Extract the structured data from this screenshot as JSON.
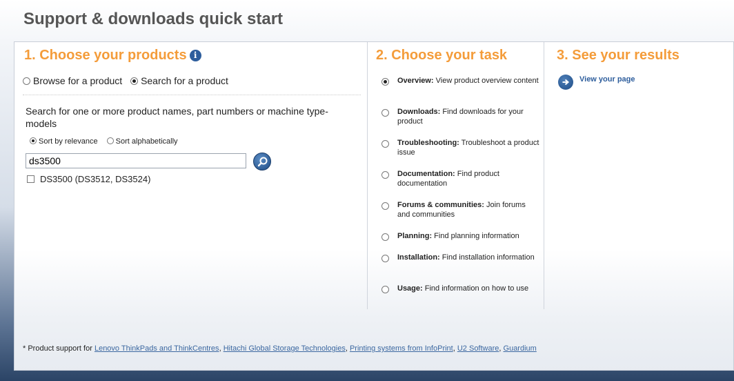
{
  "page": {
    "title": "Support & downloads quick start"
  },
  "step1": {
    "heading": "1. Choose your products",
    "info_icon": "info-icon",
    "modes": [
      {
        "label": "Browse for a product",
        "checked": false
      },
      {
        "label": "Search for a product",
        "checked": true
      }
    ],
    "search_help": "Search for one or more product names, part numbers or machine type-models",
    "sort_options": [
      {
        "label": "Sort by relevance",
        "checked": true
      },
      {
        "label": "Sort alphabetically",
        "checked": false
      }
    ],
    "search_value": "ds3500",
    "search_button_icon": "search-icon",
    "results": [
      {
        "label": "DS3500 (DS3512, DS3524)",
        "checked": false
      }
    ]
  },
  "step2": {
    "heading": "2. Choose your task",
    "tasks": [
      {
        "name": "Overview:",
        "desc": " View product overview content",
        "checked": true
      },
      {
        "name": "Downloads:",
        "desc": " Find downloads for your product",
        "checked": false
      },
      {
        "name": "Troubleshooting:",
        "desc": " Troubleshoot a product issue",
        "checked": false
      },
      {
        "name": "Documentation:",
        "desc": " Find product documentation",
        "checked": false
      },
      {
        "name": "Forums & communities:",
        "desc": " Join forums and communities",
        "checked": false
      },
      {
        "name": "Planning:",
        "desc": " Find planning information",
        "checked": false
      },
      {
        "name": "Installation:",
        "desc": " Find installation information",
        "checked": false
      },
      {
        "name": "Usage:",
        "desc": " Find information on how to use",
        "checked": false
      }
    ]
  },
  "step3": {
    "heading": "3. See your results",
    "link_icon": "arrow-right-icon",
    "link_label": "View your page"
  },
  "footer": {
    "prefix": "* Product support for ",
    "links": [
      "Lenovo ThinkPads and ThinkCentres",
      "Hitachi Global Storage Technologies",
      "Printing systems from InfoPrint",
      "U2 Software",
      "Guardium"
    ],
    "separator": ", "
  },
  "colors": {
    "heading_orange": "#f49c3a",
    "link_blue": "#3b67a0",
    "button_blue": "#1f4d86"
  }
}
